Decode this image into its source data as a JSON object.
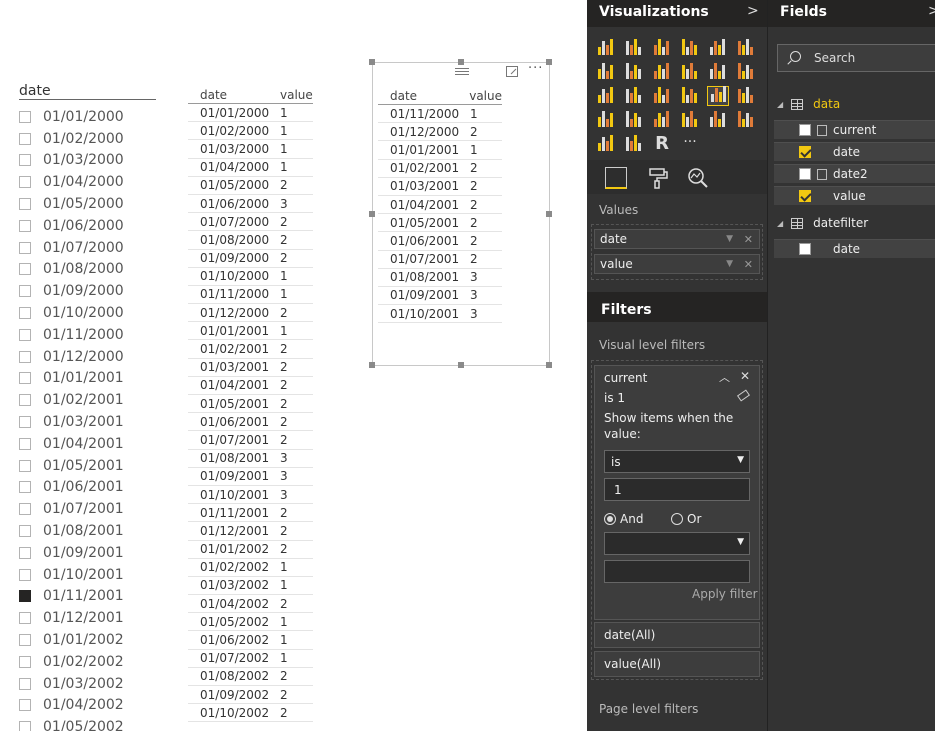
{
  "slicer": {
    "title": "date",
    "items": [
      {
        "label": "01/01/2000",
        "checked": false
      },
      {
        "label": "01/02/2000",
        "checked": false
      },
      {
        "label": "01/03/2000",
        "checked": false
      },
      {
        "label": "01/04/2000",
        "checked": false
      },
      {
        "label": "01/05/2000",
        "checked": false
      },
      {
        "label": "01/06/2000",
        "checked": false
      },
      {
        "label": "01/07/2000",
        "checked": false
      },
      {
        "label": "01/08/2000",
        "checked": false
      },
      {
        "label": "01/09/2000",
        "checked": false
      },
      {
        "label": "01/10/2000",
        "checked": false
      },
      {
        "label": "01/11/2000",
        "checked": false
      },
      {
        "label": "01/12/2000",
        "checked": false
      },
      {
        "label": "01/01/2001",
        "checked": false
      },
      {
        "label": "01/02/2001",
        "checked": false
      },
      {
        "label": "01/03/2001",
        "checked": false
      },
      {
        "label": "01/04/2001",
        "checked": false
      },
      {
        "label": "01/05/2001",
        "checked": false
      },
      {
        "label": "01/06/2001",
        "checked": false
      },
      {
        "label": "01/07/2001",
        "checked": false
      },
      {
        "label": "01/08/2001",
        "checked": false
      },
      {
        "label": "01/09/2001",
        "checked": false
      },
      {
        "label": "01/10/2001",
        "checked": false
      },
      {
        "label": "01/11/2001",
        "checked": true
      },
      {
        "label": "01/12/2001",
        "checked": false
      },
      {
        "label": "01/01/2002",
        "checked": false
      },
      {
        "label": "01/02/2002",
        "checked": false
      },
      {
        "label": "01/03/2002",
        "checked": false
      },
      {
        "label": "01/04/2002",
        "checked": false
      },
      {
        "label": "01/05/2002",
        "checked": false
      }
    ]
  },
  "table1": {
    "headers": [
      "date",
      "value"
    ],
    "rows": [
      [
        "01/01/2000",
        "1"
      ],
      [
        "01/02/2000",
        "1"
      ],
      [
        "01/03/2000",
        "1"
      ],
      [
        "01/04/2000",
        "1"
      ],
      [
        "01/05/2000",
        "2"
      ],
      [
        "01/06/2000",
        "3"
      ],
      [
        "01/07/2000",
        "2"
      ],
      [
        "01/08/2000",
        "2"
      ],
      [
        "01/09/2000",
        "2"
      ],
      [
        "01/10/2000",
        "1"
      ],
      [
        "01/11/2000",
        "1"
      ],
      [
        "01/12/2000",
        "2"
      ],
      [
        "01/01/2001",
        "1"
      ],
      [
        "01/02/2001",
        "2"
      ],
      [
        "01/03/2001",
        "2"
      ],
      [
        "01/04/2001",
        "2"
      ],
      [
        "01/05/2001",
        "2"
      ],
      [
        "01/06/2001",
        "2"
      ],
      [
        "01/07/2001",
        "2"
      ],
      [
        "01/08/2001",
        "3"
      ],
      [
        "01/09/2001",
        "3"
      ],
      [
        "01/10/2001",
        "3"
      ],
      [
        "01/11/2001",
        "2"
      ],
      [
        "01/12/2001",
        "2"
      ],
      [
        "01/01/2002",
        "2"
      ],
      [
        "01/02/2002",
        "1"
      ],
      [
        "01/03/2002",
        "1"
      ],
      [
        "01/04/2002",
        "2"
      ],
      [
        "01/05/2002",
        "1"
      ],
      [
        "01/06/2002",
        "1"
      ],
      [
        "01/07/2002",
        "1"
      ],
      [
        "01/08/2002",
        "2"
      ],
      [
        "01/09/2002",
        "2"
      ],
      [
        "01/10/2002",
        "2"
      ]
    ]
  },
  "table2": {
    "headers": [
      "date",
      "value"
    ],
    "rows": [
      [
        "01/11/2000",
        "1"
      ],
      [
        "01/12/2000",
        "2"
      ],
      [
        "01/01/2001",
        "1"
      ],
      [
        "01/02/2001",
        "2"
      ],
      [
        "01/03/2001",
        "2"
      ],
      [
        "01/04/2001",
        "2"
      ],
      [
        "01/05/2001",
        "2"
      ],
      [
        "01/06/2001",
        "2"
      ],
      [
        "01/07/2001",
        "2"
      ],
      [
        "01/08/2001",
        "3"
      ],
      [
        "01/09/2001",
        "3"
      ],
      [
        "01/10/2001",
        "3"
      ]
    ],
    "more_glyph": "···"
  },
  "visualizations": {
    "title": "Visualizations",
    "collapse_glyph": ">",
    "icons": [
      "stacked-bar-icon",
      "stacked-column-icon",
      "clustered-bar-icon",
      "clustered-column-icon",
      "100-bar-icon",
      "100-column-icon",
      "line-icon",
      "area-icon",
      "stacked-area-icon",
      "line-column-icon",
      "line-clustered-icon",
      "ribbon-icon",
      "scatter-icon",
      "pie-icon",
      "treemap-icon",
      "map-icon",
      "table-icon",
      "matrix-icon",
      "filled-map-icon",
      "funnel-icon",
      "gauge-icon",
      "multirow-card-icon",
      "card-icon",
      "kpi-icon",
      "slicer-icon",
      "donut-icon",
      "r-script-icon",
      "more-icon"
    ],
    "selected_icon": 16,
    "r_glyph": "R",
    "more_glyph": "···",
    "values_label": "Values",
    "wells": [
      {
        "label": "date"
      },
      {
        "label": "value"
      }
    ]
  },
  "filters": {
    "title": "Filters",
    "visual_level_label": "Visual level filters",
    "card": {
      "field": "current",
      "summary": "is 1",
      "show_items": "Show items when the value:",
      "operator": "is",
      "value": "1",
      "and_label": "And",
      "or_label": "Or",
      "logic": "And",
      "apply_label": "Apply filter"
    },
    "pills": [
      "date(All)",
      "value(All)"
    ],
    "page_level_label": "Page level filters"
  },
  "fields": {
    "title": "Fields",
    "collapse_glyph": ">",
    "search_placeholder": "Search",
    "tables": [
      {
        "name": "data",
        "fields": [
          {
            "name": "current",
            "checked": false,
            "icon": "measure-icon"
          },
          {
            "name": "date",
            "checked": true,
            "icon": ""
          },
          {
            "name": "date2",
            "checked": false,
            "icon": "calculated-column-icon"
          },
          {
            "name": "value",
            "checked": true,
            "icon": ""
          }
        ]
      },
      {
        "name": "datefilter",
        "fields": [
          {
            "name": "date",
            "checked": false,
            "icon": ""
          }
        ]
      }
    ]
  },
  "colors": {
    "accent": "#f2c811",
    "pane_bg": "#333333",
    "pane_header": "#252423"
  }
}
